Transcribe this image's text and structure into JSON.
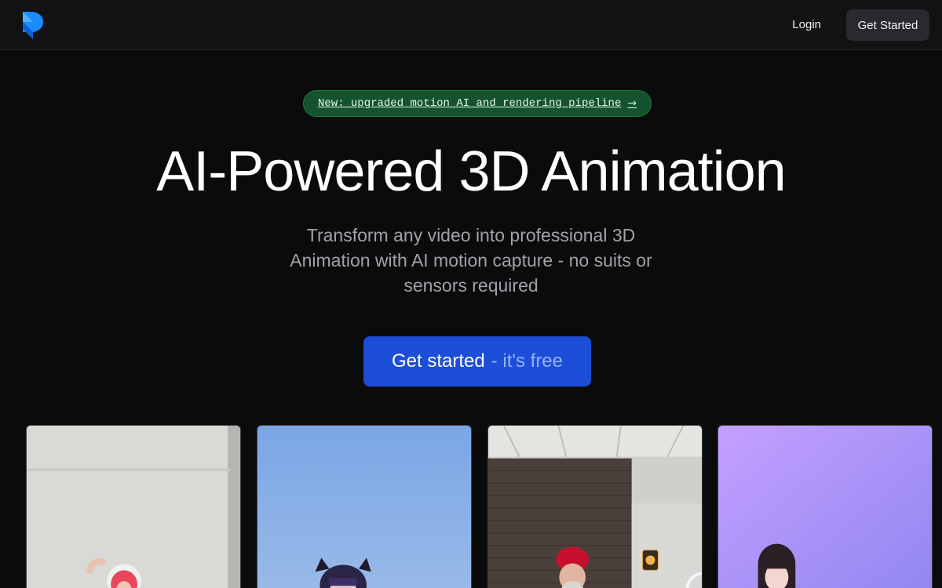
{
  "nav": {
    "login_label": "Login",
    "cta_label": "Get Started"
  },
  "announcement": {
    "text": "New: upgraded motion AI and rendering pipeline",
    "arrow_icon": "arrow-right-icon"
  },
  "hero": {
    "title": "AI-Powered 3D Animation",
    "subtitle": "Transform any video into professional 3D Animation with AI motion capture - no suits or sensors required",
    "cta_main": "Get started",
    "cta_sub": "- it's free"
  },
  "colors": {
    "background": "#0b0b0c",
    "navbar": "#121214",
    "accent_blue": "#1d4ed8",
    "badge_green": "#14532d",
    "logo_blue": "#1a8cff"
  },
  "gallery": {
    "cards": [
      {
        "name": "video-person-waving"
      },
      {
        "name": "avatar-cat-ears"
      },
      {
        "name": "video-man-red-beanie"
      },
      {
        "name": "avatar-dark-hair"
      }
    ]
  }
}
